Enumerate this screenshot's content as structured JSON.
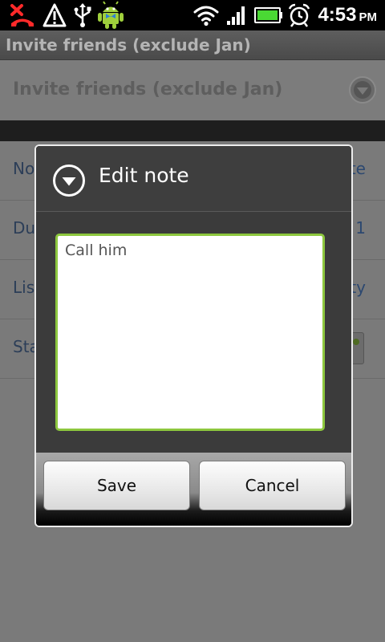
{
  "status_bar": {
    "icons": [
      "missed-call-icon",
      "signal-alert-icon",
      "usb-icon",
      "android-icon",
      "wifi-icon",
      "cell-signal-icon",
      "battery-icon",
      "alarm-icon"
    ],
    "time": "4:53",
    "ampm": "PM"
  },
  "title_bar": {
    "title": "Invite friends (exclude Jan)"
  },
  "background": {
    "list_selector": "Invite friends (exclude Jan)",
    "rows": [
      {
        "left": "No",
        "right": "te"
      },
      {
        "left": "Du",
        "right": "1"
      },
      {
        "left": "List",
        "right": "ty"
      },
      {
        "left": "Sta",
        "right": ""
      }
    ]
  },
  "dialog": {
    "title": "Edit note",
    "note_value": "Call him",
    "save_label": "Save",
    "cancel_label": "Cancel"
  },
  "colors": {
    "field_focus_border": "#8dc73e",
    "dialog_border": "#ececec",
    "dimmed_background": "#7a7a7a"
  }
}
